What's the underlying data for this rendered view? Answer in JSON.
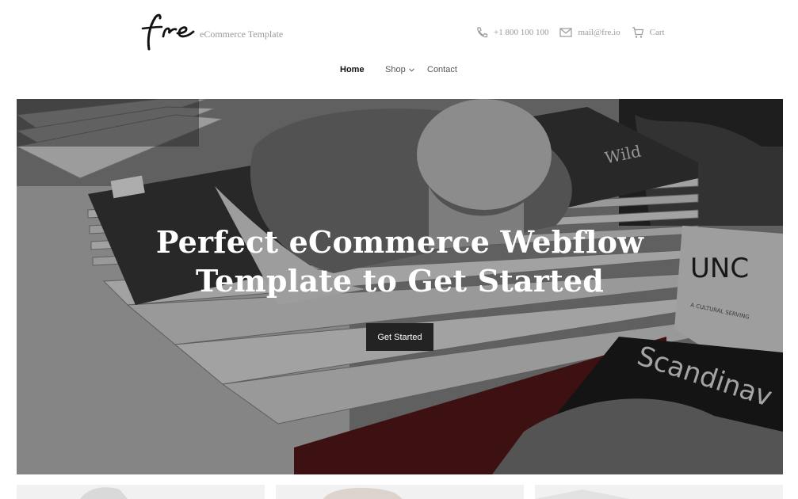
{
  "header": {
    "logo_icon": "fre-script-logo",
    "tagline": "eCommerce Template",
    "phone": {
      "icon": "phone-icon",
      "label": "+1 800 100 100"
    },
    "mail": {
      "icon": "mail-icon",
      "label": "mail@fre.io"
    },
    "cart": {
      "icon": "cart-icon",
      "label": "Cart"
    }
  },
  "nav": {
    "items": [
      {
        "label": "Home",
        "active": true
      },
      {
        "label": "Shop",
        "has_dropdown": true
      },
      {
        "label": "Contact"
      }
    ]
  },
  "hero": {
    "title_line1": "Perfect eCommerce Webflow",
    "title_line2": "Template to Get Started",
    "button_label": "Get Started",
    "magazine_text_1": "UNC",
    "magazine_text_2": "Scandinav",
    "magazine_text_3": "Wild",
    "magazine_text_4": "A CULTURAL SERVING"
  },
  "colors": {
    "accent_button": "#232323",
    "muted_text": "#9a9a9a",
    "nav_active": "#111111"
  }
}
